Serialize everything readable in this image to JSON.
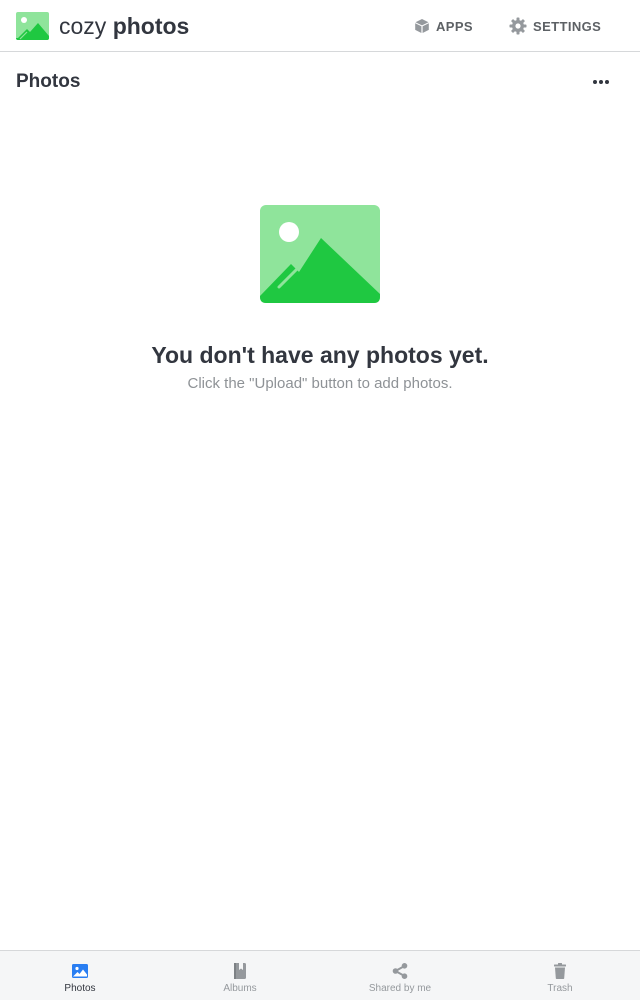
{
  "app": {
    "name_light": "cozy",
    "name_bold": "photos",
    "logo_icon": "photo-landscape-icon"
  },
  "topbar": {
    "apps_label": "APPS",
    "apps_icon": "cube-icon",
    "settings_label": "SETTINGS",
    "settings_icon": "gear-icon"
  },
  "page": {
    "title": "Photos",
    "more_icon": "ellipsis-icon"
  },
  "empty_state": {
    "illustration_icon": "photo-landscape-icon",
    "title": "You don't have any photos yet.",
    "text": "Click the \"Upload\" button to add photos."
  },
  "bottom_nav": {
    "items": [
      {
        "label": "Photos",
        "icon": "image-icon",
        "active": true
      },
      {
        "label": "Albums",
        "icon": "album-icon",
        "active": false
      },
      {
        "label": "Shared by me",
        "icon": "share-icon",
        "active": false
      },
      {
        "label": "Trash",
        "icon": "trash-icon",
        "active": false
      }
    ]
  },
  "colors": {
    "brand_green_light": "#8fe49b",
    "brand_green": "#1fc841",
    "text_primary": "#32363f",
    "text_secondary": "#8e9296",
    "nav_active": "#297ef2",
    "nav_inactive": "#95999d"
  }
}
